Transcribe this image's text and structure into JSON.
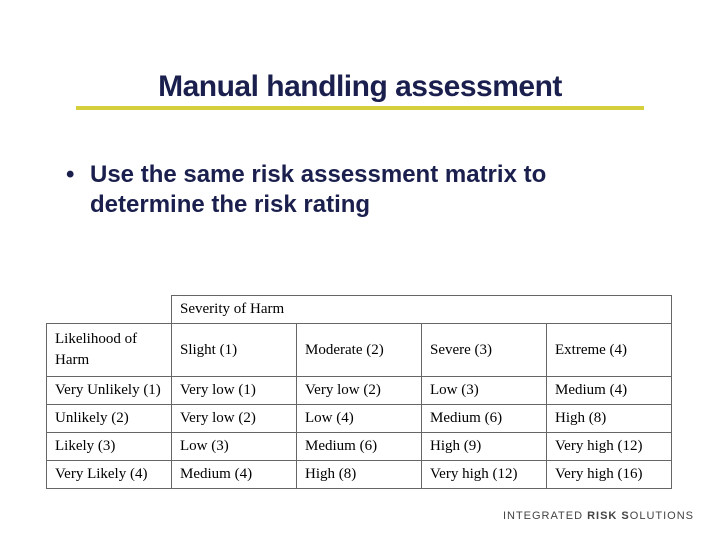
{
  "title": "Manual handling assessment",
  "bullet": {
    "marker": "•",
    "text": "Use the same risk assessment matrix to determine the risk rating"
  },
  "matrix": {
    "severity_label": "Severity of Harm",
    "likelihood_label_line1": "Likelihood of",
    "likelihood_label_line2": "Harm",
    "col_headers": [
      "Slight (1)",
      "Moderate (2)",
      "Severe (3)",
      "Extreme (4)"
    ],
    "rows": [
      {
        "label": "Very Unlikely (1)",
        "cells": [
          "Very low (1)",
          "Very low (2)",
          "Low (3)",
          "Medium (4)"
        ]
      },
      {
        "label": "Unlikely (2)",
        "cells": [
          "Very low (2)",
          "Low (4)",
          "Medium (6)",
          "High (8)"
        ]
      },
      {
        "label": "Likely (3)",
        "cells": [
          "Low (3)",
          "Medium (6)",
          "High (9)",
          "Very high (12)"
        ]
      },
      {
        "label": "Very Likely (4)",
        "cells": [
          "Medium (4)",
          "High (8)",
          "Very high (12)",
          "Very high (16)"
        ]
      }
    ]
  },
  "footer": {
    "word1": "INTEGRATED",
    "word2": "RISK",
    "word3_prefix": "S",
    "word3_rest": "OLUTIONS"
  }
}
